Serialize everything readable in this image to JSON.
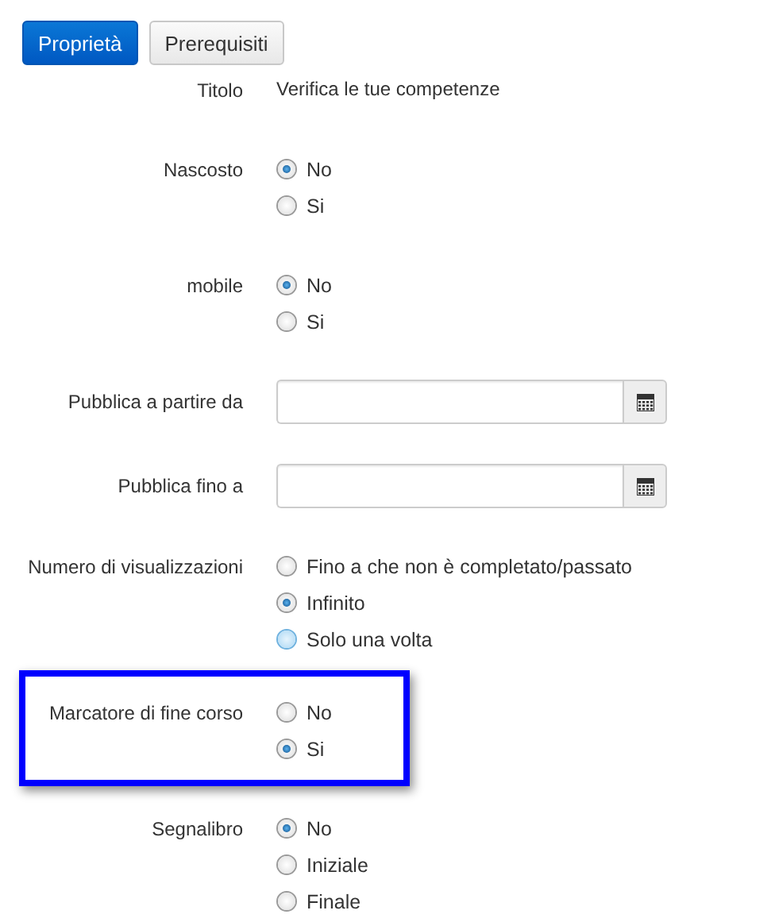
{
  "tabs": [
    {
      "label": "Proprietà",
      "selected": true
    },
    {
      "label": "Prerequisiti",
      "selected": false
    }
  ],
  "fields": [
    {
      "kind": "text",
      "label": "Titolo",
      "value": "Verifica le tue competenze",
      "highlighted": false
    },
    {
      "kind": "radio",
      "label": "Nascosto",
      "highlighted": false,
      "options": [
        {
          "label": "No",
          "selected": true,
          "hovered": false
        },
        {
          "label": "Si",
          "selected": false,
          "hovered": false
        }
      ]
    },
    {
      "kind": "radio",
      "label": "mobile",
      "highlighted": false,
      "options": [
        {
          "label": "No",
          "selected": true,
          "hovered": false
        },
        {
          "label": "Si",
          "selected": false,
          "hovered": false
        }
      ]
    },
    {
      "kind": "date",
      "label": "Pubblica a partire da",
      "highlighted": false
    },
    {
      "kind": "date",
      "label": "Pubblica fino a",
      "highlighted": false
    },
    {
      "kind": "radio",
      "label": "Numero di visualizzazioni",
      "highlighted": false,
      "options": [
        {
          "label": "Fino a che non è completato/passato",
          "selected": false,
          "hovered": false
        },
        {
          "label": "Infinito",
          "selected": true,
          "hovered": false
        },
        {
          "label": "Solo una volta",
          "selected": false,
          "hovered": true
        }
      ]
    },
    {
      "kind": "radio",
      "label": "Marcatore di fine corso",
      "highlighted": true,
      "options": [
        {
          "label": "No",
          "selected": false,
          "hovered": false
        },
        {
          "label": "Si",
          "selected": true,
          "hovered": false
        }
      ]
    },
    {
      "kind": "radio",
      "label": "Segnalibro",
      "highlighted": false,
      "options": [
        {
          "label": "No",
          "selected": true,
          "hovered": false
        },
        {
          "label": "Iniziale",
          "selected": false,
          "hovered": false
        },
        {
          "label": "Finale",
          "selected": false,
          "hovered": false
        }
      ]
    }
  ]
}
